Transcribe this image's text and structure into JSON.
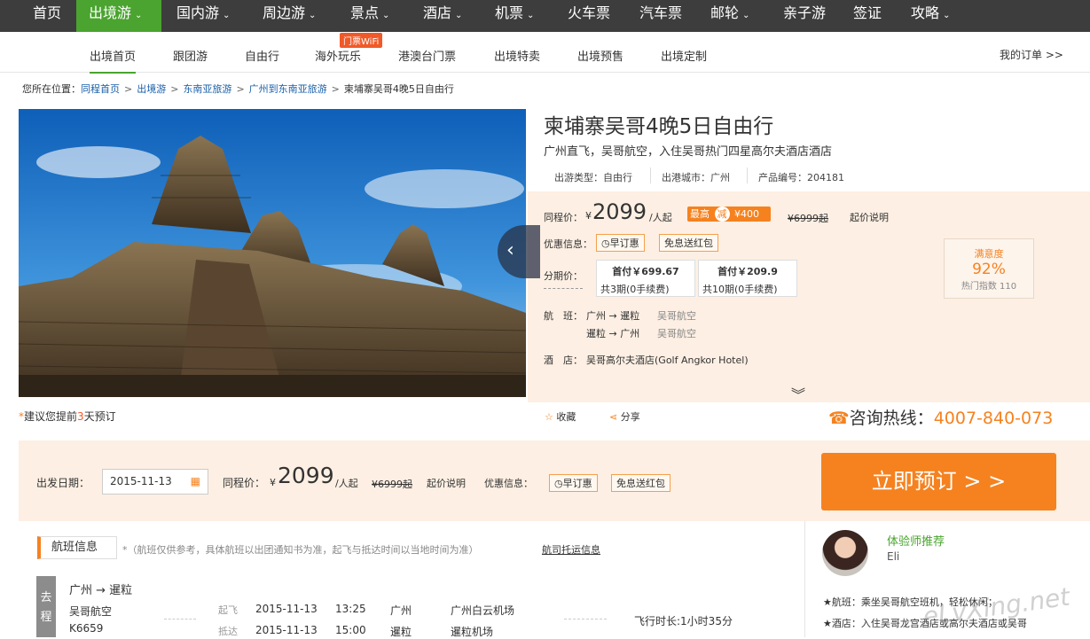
{
  "topnav": {
    "items": [
      "首页",
      "出境游",
      "国内游",
      "周边游",
      "景点",
      "酒店",
      "机票",
      "火车票",
      "汽车票",
      "邮轮",
      "亲子游",
      "签证",
      "攻略"
    ],
    "active": "出境游",
    "dropdown_flags": [
      "",
      "v",
      "v",
      "v",
      "v",
      "v",
      "v",
      "",
      "",
      "v",
      "",
      "",
      "v"
    ]
  },
  "subnav": {
    "items": [
      "出境首页",
      "跟团游",
      "自由行",
      "海外玩乐",
      "港澳台门票",
      "出境特卖",
      "出境预售",
      "出境定制"
    ],
    "active": "出境首页",
    "wifi_badge": "门票WiFi",
    "my_orders": "我的订单 >>"
  },
  "breadcrumb": {
    "prefix": "您所在位置：",
    "links": [
      "同程首页",
      "出境游",
      "东南亚旅游",
      "广州到东南亚旅游"
    ],
    "current": "柬埔寨吴哥4晚5日自由行",
    "sep": ">"
  },
  "product": {
    "title": "柬埔寨吴哥4晚5日自由行",
    "subtitle": "广州直飞，吴哥航空，入住吴哥热门四星高尔夫酒店酒店",
    "meta": {
      "type": "出游类型：自由行",
      "city": "出港城市：广州",
      "code": "产品编号：204181"
    },
    "price_label": "同程价：",
    "price_currency": "¥",
    "price": "2099",
    "price_unit": "/人起",
    "max_label": "最高",
    "reduce_icon": "减",
    "reduce_amount": "¥400",
    "orig_price": "¥6999起",
    "price_explain": "起价说明",
    "promo_label": "优惠信息：",
    "promo_tags": [
      "早订惠",
      "免息送红包"
    ],
    "installment_label": "分期价：",
    "installments": [
      {
        "first": "首付￥699.67",
        "periods": "共3期(0手续费)"
      },
      {
        "first": "首付￥209.9",
        "periods": "共10期(0手续费)"
      }
    ],
    "satisfaction": {
      "label": "满意度",
      "value": "92%",
      "hot": "热门指数 110"
    },
    "flight_label": "航　班：",
    "flights": [
      {
        "route": "广州 → 暹粒",
        "airline": "吴哥航空"
      },
      {
        "route": "暹粒 → 广州",
        "airline": "吴哥航空"
      }
    ],
    "hotel_label": "酒　店：",
    "hotel": "吴哥高尔夫酒店(Golf Angkor Hotel)"
  },
  "gallery": {
    "prev_icon": "‹"
  },
  "note": {
    "prefix": "*",
    "text1": "建议您提前",
    "days": "3",
    "text2": "天预订"
  },
  "actions": {
    "favorite": "收藏",
    "share": "分享",
    "hotline_label": "咨询热线：",
    "hotline": "4007-840-073"
  },
  "booking": {
    "date_label": "出发日期：",
    "date": "2015-11-13",
    "price_label": "同程价：",
    "currency": "¥",
    "price": "2099",
    "unit": "/人起",
    "orig": "¥6999起",
    "explain": "起价说明",
    "promo_label": "优惠信息：",
    "tags": [
      "早订惠",
      "免息送红包"
    ],
    "book_button": "立即预订 > >"
  },
  "flight_section": {
    "title": "航班信息",
    "notice": "*（航班仅供参考，具体航班以出团通知书为准，起飞与抵达时间以当地时间为准）",
    "link": "航司托运信息",
    "go_label": "去程",
    "route": "广州 → 暹粒",
    "airline": "吴哥航空",
    "flight_no": "K6659",
    "depart_label": "起飞",
    "arrive_label": "抵达",
    "depart_date": "2015-11-13",
    "depart_time": "13:25",
    "depart_city": "广州",
    "depart_airport": "广州白云机场",
    "arrive_date": "2015-11-13",
    "arrive_time": "15:00",
    "arrive_city": "暹粒",
    "arrive_airport": "暹粒机场",
    "duration": "飞行时长:1小时35分"
  },
  "recommend": {
    "title": "体验师推荐",
    "name": "Eli",
    "line1": "★航班：乘坐吴哥航空班机，轻松休闲；",
    "line2": "★酒店：入住吴哥龙宫酒店或高尔夫酒店或吴哥"
  },
  "watermark": "eLvXing.net",
  "colors": {
    "nav_bg": "#3d3d3d",
    "nav_active": "#4aa42f",
    "accent": "#f5821f",
    "link": "#1a5fa8",
    "panel": "#fdefe3"
  }
}
